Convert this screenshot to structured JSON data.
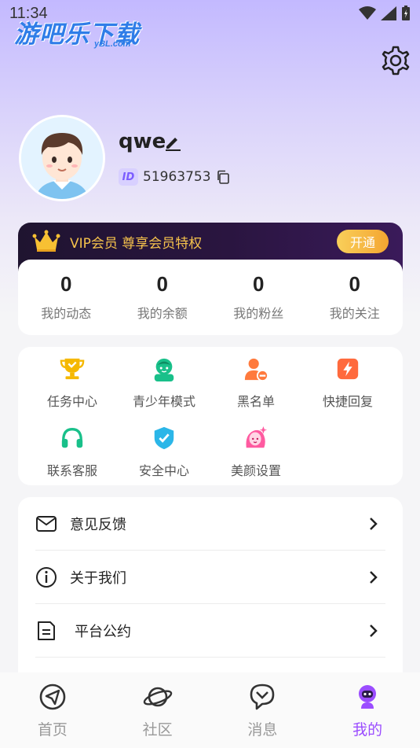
{
  "status_bar": {
    "time": "11:34"
  },
  "watermark": {
    "brand": "游吧乐下载",
    "domain": "yBL.com"
  },
  "profile": {
    "username": "qwe",
    "id_badge": "ID",
    "id_number": "51963753"
  },
  "vip": {
    "text": "VIP会员 尊享会员特权",
    "button": "开通"
  },
  "stats": [
    {
      "value": "0",
      "label": "我的动态"
    },
    {
      "value": "0",
      "label": "我的余额"
    },
    {
      "value": "0",
      "label": "我的粉丝"
    },
    {
      "value": "0",
      "label": "我的关注"
    }
  ],
  "features": [
    {
      "label": "任务中心",
      "icon": "trophy-icon"
    },
    {
      "label": "青少年模式",
      "icon": "teen-icon"
    },
    {
      "label": "黑名单",
      "icon": "blacklist-icon"
    },
    {
      "label": "快捷回复",
      "icon": "lightning-icon"
    },
    {
      "label": "联系客服",
      "icon": "headphones-icon"
    },
    {
      "label": "安全中心",
      "icon": "shield-icon"
    },
    {
      "label": "美颜设置",
      "icon": "beauty-icon"
    }
  ],
  "menu": [
    {
      "label": "意见反馈",
      "icon": "mail-icon"
    },
    {
      "label": "关于我们",
      "icon": "info-icon"
    },
    {
      "label": "平台公约",
      "icon": "document-icon"
    }
  ],
  "tabs": [
    {
      "label": "首页",
      "icon": "send-icon",
      "active": false
    },
    {
      "label": "社区",
      "icon": "planet-icon",
      "active": false
    },
    {
      "label": "消息",
      "icon": "message-heart-icon",
      "active": false
    },
    {
      "label": "我的",
      "icon": "profile-bot-icon",
      "active": true
    }
  ],
  "colors": {
    "accent": "#9b4dff",
    "vip_gold": "#f5c24c",
    "vip_button": "#f4a531",
    "trophy": "#f5b800",
    "teen": "#19c08a",
    "blacklist": "#ff7a3d",
    "lightning": "#ff6a3d",
    "headphones": "#19c08a",
    "shield": "#2bb6e8",
    "beauty": "#ff5aa0"
  }
}
